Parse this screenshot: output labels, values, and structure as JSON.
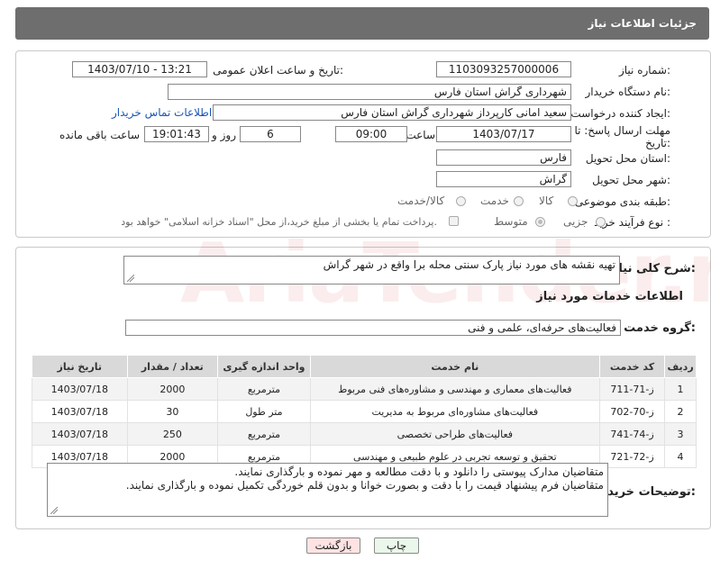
{
  "header": {
    "title": "جزئیات اطلاعات نیاز"
  },
  "form": {
    "need_number_label": "شماره نیاز:",
    "need_number": "1103093257000006",
    "announce_label": "تاریخ و ساعت اعلان عمومی:",
    "announce_value": "1403/07/10 - 13:21",
    "buyer_org_label": "نام دستگاه خریدار:",
    "buyer_org": "شهرداری گراش استان فارس",
    "creator_label": "ایجاد کننده درخواست:",
    "creator": "سعید امانی کارپرداز شهرداری گراش استان فارس",
    "contact_link": "اطلاعات تماس خریدار",
    "deadline_label_1": "مهلت ارسال پاسخ: تا",
    "deadline_label_2": "تاریخ:",
    "deadline_date": "1403/07/17",
    "time_label": "ساعت",
    "deadline_time": "09:00",
    "days_value": "6",
    "days_label": "روز و",
    "remaining_time": "19:01:43",
    "remaining_label": "ساعت باقی مانده",
    "province_label": "استان محل تحویل:",
    "province": "فارس",
    "city_label": "شهر محل تحویل:",
    "city": "گراش",
    "category_label": "طبقه بندی موضوعی:",
    "category_options": [
      "کالا",
      "خدمت",
      "کالا/خدمت"
    ],
    "process_label": "نوع فرآیند خرید :",
    "process_options": [
      "جزیی",
      "متوسط"
    ],
    "payment_note": "پرداخت تمام یا بخشی از مبلغ خرید،از محل \"اسناد خزانه اسلامی\" خواهد بود."
  },
  "details": {
    "summary_label": "شرح کلی نیاز:",
    "summary": "تهیه نقشه های مورد نیاز پارک سنتی محله برا واقع در شهر گراش",
    "services_title": "اطلاعات خدمات مورد نیاز",
    "group_label": "گروه خدمت:",
    "group_value": "فعالیت‌های حرفه‌ای، علمی و فنی",
    "table": {
      "headers": [
        "ردیف",
        "کد خدمت",
        "نام خدمت",
        "واحد اندازه گیری",
        "تعداد / مقدار",
        "تاریخ نیاز"
      ],
      "rows": [
        [
          "1",
          "ز-71-711",
          "فعالیت‌های معماری و مهندسی و مشاوره‌های فنی مربوط",
          "مترمربع",
          "2000",
          "1403/07/18"
        ],
        [
          "2",
          "ز-70-702",
          "فعالیت‌های مشاوره‌ای مربوط به مدیریت",
          "متر طول",
          "30",
          "1403/07/18"
        ],
        [
          "3",
          "ز-74-741",
          "فعالیت‌های طراحی تخصصی",
          "مترمربع",
          "250",
          "1403/07/18"
        ],
        [
          "4",
          "ز-72-721",
          "تحقیق و توسعه تجربی در علوم طبیعی و مهندسی",
          "مترمربع",
          "2000",
          "1403/07/18"
        ]
      ]
    },
    "buyer_notes_label": "توضیحات خریدار:",
    "buyer_notes_1": "متقاضیان مدارک پیوستی را دانلود و با دقت مطالعه و مهر نموده و بارگذاری نمایند.",
    "buyer_notes_2": "متقاضیان فرم پیشنهاد قیمت را با دقت و بصورت خوانا و بدون قلم خوردگی تکمیل نموده و بارگذاری نمایند."
  },
  "buttons": {
    "print": "چاپ",
    "back": "بازگشت"
  },
  "colors": {
    "header_bg": "#6e6e6e",
    "link": "#1a55b5",
    "back_bg": "#ffe0e0",
    "print_bg": "#e6f7e6"
  }
}
